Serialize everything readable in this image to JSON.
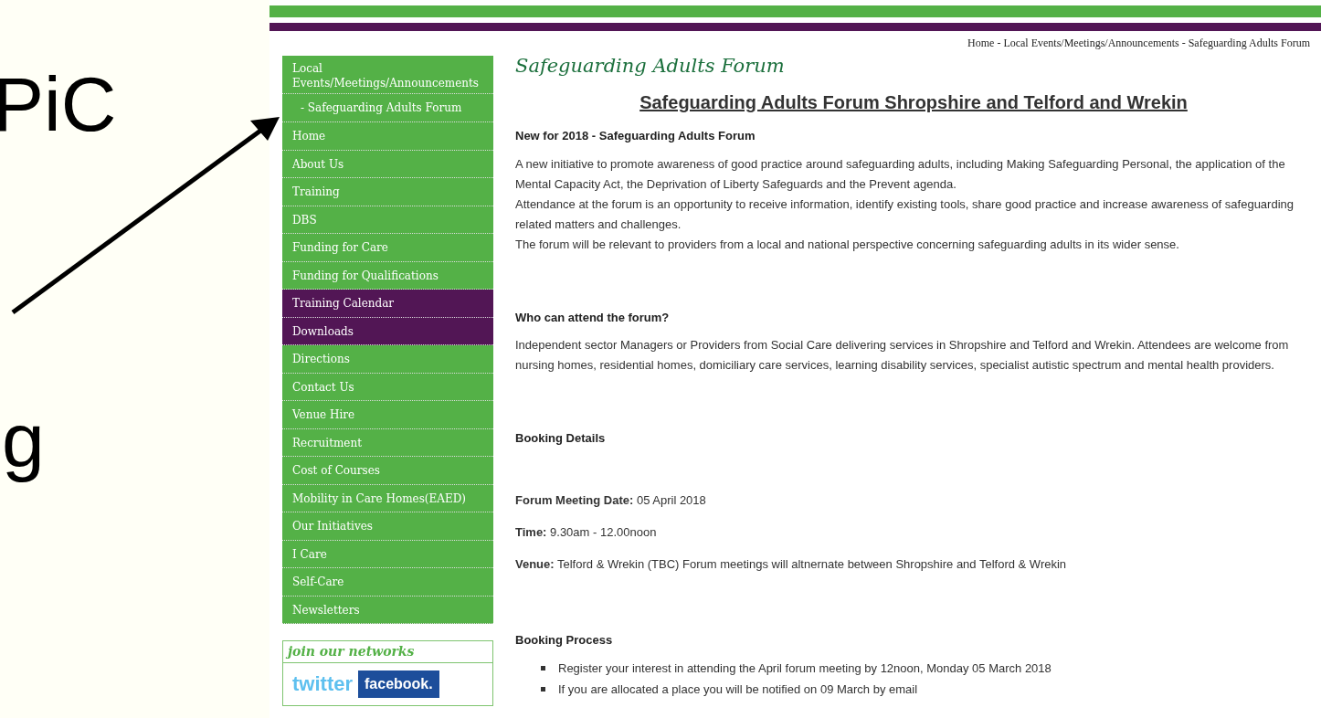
{
  "slide": {
    "texts": [
      "PiC",
      "g"
    ]
  },
  "breadcrumb": "Home - Local Events/Meetings/Announcements - Safeguarding Adults Forum",
  "sidebar": {
    "items": [
      {
        "label": "Local Events/Meetings/Announcements",
        "color": "#54b147",
        "kind": "parent"
      },
      {
        "label": "- Safeguarding Adults Forum",
        "color": "#54b147",
        "kind": "child"
      },
      {
        "label": "Home",
        "color": "#54b147",
        "kind": "item"
      },
      {
        "label": "About Us",
        "color": "#54b147",
        "kind": "item"
      },
      {
        "label": "Training",
        "color": "#54b147",
        "kind": "item"
      },
      {
        "label": "DBS",
        "color": "#54b147",
        "kind": "item"
      },
      {
        "label": "Funding for Care",
        "color": "#54b147",
        "kind": "item"
      },
      {
        "label": "Funding for Qualifications",
        "color": "#54b147",
        "kind": "item"
      },
      {
        "label": "Training Calendar",
        "color": "#521655",
        "kind": "item"
      },
      {
        "label": "Downloads",
        "color": "#521655",
        "kind": "item"
      },
      {
        "label": "Directions",
        "color": "#54b147",
        "kind": "item"
      },
      {
        "label": "Contact Us",
        "color": "#54b147",
        "kind": "item"
      },
      {
        "label": "Venue Hire",
        "color": "#54b147",
        "kind": "item"
      },
      {
        "label": "Recruitment",
        "color": "#54b147",
        "kind": "item"
      },
      {
        "label": "Cost of Courses",
        "color": "#54b147",
        "kind": "item"
      },
      {
        "label": "Mobility in Care Homes(EAED)",
        "color": "#54b147",
        "kind": "item"
      },
      {
        "label": "Our Initiatives",
        "color": "#54b147",
        "kind": "item"
      },
      {
        "label": "I Care",
        "color": "#54b147",
        "kind": "item"
      },
      {
        "label": "Self-Care",
        "color": "#54b147",
        "kind": "item"
      },
      {
        "label": "Newsletters",
        "color": "#54b147",
        "kind": "item"
      }
    ],
    "networks": {
      "title": "join our networks",
      "links": [
        {
          "label": "twitter",
          "kind": "twitter"
        },
        {
          "label": "facebook.",
          "kind": "facebook"
        }
      ]
    }
  },
  "content": {
    "title": "Safeguarding Adults Forum",
    "heading": "Safeguarding Adults Forum Shropshire and Telford and Wrekin",
    "blocks": [
      {
        "kind": "subheading",
        "text": "New for 2018 - Safeguarding Adults Forum"
      },
      {
        "kind": "lines",
        "lines": [
          "A new initiative to promote awareness of good practice around safeguarding adults, including Making Safeguarding Personal, the application of the Mental Capacity Act, the Deprivation of Liberty Safeguards and the Prevent agenda.",
          "Attendance at the forum is an opportunity to receive information, identify existing tools, share good practice and increase awareness of safeguarding related matters and challenges.",
          "The forum will be relevant to providers from a local and national perspective concerning safeguarding adults in its wider sense."
        ]
      },
      {
        "kind": "spacer"
      },
      {
        "kind": "subheading",
        "text": "Who can attend the forum?"
      },
      {
        "kind": "lines",
        "lines": [
          "Independent sector Managers or Providers from Social Care delivering services in Shropshire and Telford and Wrekin. Attendees are welcome from nursing homes, residential homes, domiciliary care services, learning disability services, specialist autistic spectrum and mental health providers."
        ]
      },
      {
        "kind": "spacer"
      },
      {
        "kind": "subheading",
        "text": "Booking Details"
      },
      {
        "kind": "spacer"
      },
      {
        "kind": "paragraph",
        "text": "**Forum Meeting Date:** 05 April 2018"
      },
      {
        "kind": "paragraph",
        "text": "**Time:** 9.30am - 12.00noon"
      },
      {
        "kind": "paragraph",
        "text": "**Venue:** Telford & Wrekin (TBC) Forum meetings will altnernate between Shropshire and Telford & Wrekin"
      },
      {
        "kind": "spacer"
      },
      {
        "kind": "subheading",
        "text": "Booking Process"
      },
      {
        "kind": "bullets",
        "items": [
          "Register your interest in attending the April forum meeting by 12noon, Monday 05 March 2018",
          "If you are allocated a place you will be notified on 09 March by email"
        ]
      }
    ]
  }
}
